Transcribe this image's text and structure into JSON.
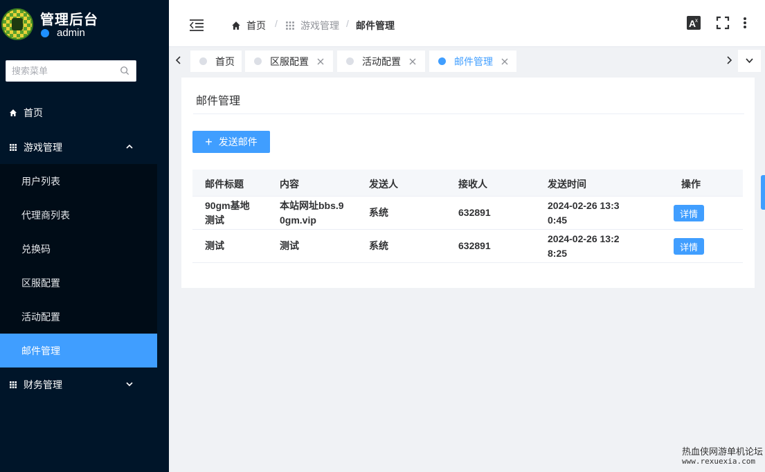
{
  "app": {
    "title": "管理后台",
    "user": "admin"
  },
  "sidebar": {
    "search_placeholder": "搜索菜单",
    "items": [
      {
        "label": "首页",
        "icon": "home-icon"
      },
      {
        "label": "游戏管理",
        "icon": "grid-icon",
        "expanded": true,
        "children": [
          "用户列表",
          "代理商列表",
          "兑换码",
          "区服配置",
          "活动配置",
          "邮件管理"
        ],
        "active_child": "邮件管理"
      },
      {
        "label": "财务管理",
        "icon": "grid-icon",
        "expanded": false
      }
    ]
  },
  "header": {
    "breadcrumb": [
      "首页",
      "游戏管理",
      "邮件管理"
    ]
  },
  "tabs": [
    {
      "label": "首页",
      "closable": false,
      "active": false
    },
    {
      "label": "区服配置",
      "closable": true,
      "active": false
    },
    {
      "label": "活动配置",
      "closable": true,
      "active": false
    },
    {
      "label": "邮件管理",
      "closable": true,
      "active": true
    }
  ],
  "main": {
    "title": "邮件管理",
    "send_button": "发送邮件",
    "table": {
      "columns": [
        "邮件标题",
        "内容",
        "发送人",
        "接收人",
        "发送时间",
        "操作"
      ],
      "rows": [
        {
          "title": [
            "90gm基地",
            "测试"
          ],
          "content": [
            "本站网址bbs.9",
            "0gm.vip"
          ],
          "sender": "系统",
          "receiver": "632891",
          "time": [
            "2024-02-26 13:3",
            "0:45"
          ],
          "action": "详情"
        },
        {
          "title": [
            "测试"
          ],
          "content": [
            "测试"
          ],
          "sender": "系统",
          "receiver": "632891",
          "time": [
            "2024-02-26 13:2",
            "8:25"
          ],
          "action": "详情"
        }
      ]
    }
  },
  "watermark": {
    "line1": "热血侠网游单机论坛",
    "line2": "www.rexuexia.com"
  },
  "colors": {
    "sidebar_bg": "#001529",
    "submenu_bg": "#000c17",
    "accent": "#409eff"
  }
}
